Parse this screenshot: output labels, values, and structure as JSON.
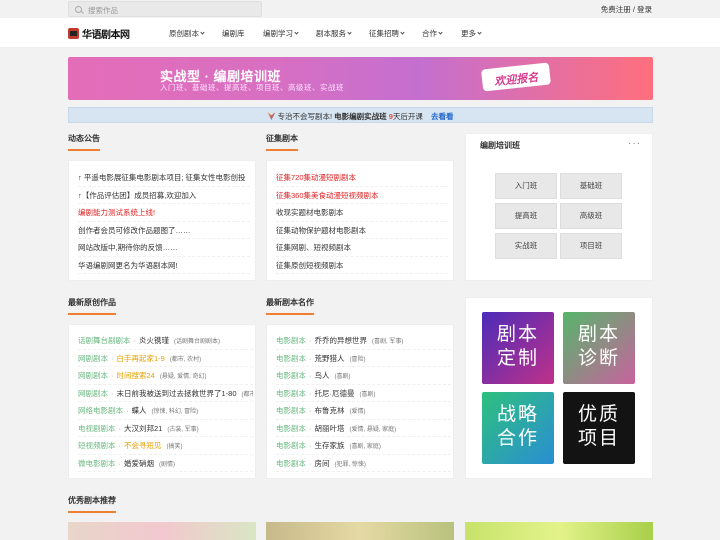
{
  "topbar": {
    "search_placeholder": "搜索作品",
    "auth": "免费注册 / 登录"
  },
  "nav": {
    "logo": "华语剧本网",
    "items": [
      "原创剧本",
      "编剧库",
      "编剧学习",
      "剧本服务",
      "征集招聘",
      "合作",
      "更多"
    ]
  },
  "banner": {
    "title": "实战型 · 编剧培训班",
    "subtitle": "入门班、基础班、提高班、项目班、高级班、实战班",
    "cta": "欢迎报名"
  },
  "notice": {
    "prefix": "专治不会写剧本!",
    "highlight": "电影编剧实战班",
    "count": "9",
    "suffix": "天后开课",
    "link": "去看看"
  },
  "announcements": {
    "title": "动态公告",
    "items": [
      {
        "text": "↑ 平遥电影展征集电影剧本项目; 征集女性电影创投",
        "red": false
      },
      {
        "text": "↑【作品评估团】成员招募,欢迎加入",
        "red": false
      },
      {
        "text": "编剧能力测试系统上线!",
        "red": true
      },
      {
        "text": "创作者会员可修改作品题图了……",
        "red": false
      },
      {
        "text": "网站改版中,期待你的反馈……",
        "red": false
      },
      {
        "text": "华语编剧网更名为华语剧本网!",
        "red": false
      }
    ]
  },
  "collect": {
    "title": "征集剧本",
    "items": [
      {
        "text": "征集720集动漫短剧剧本",
        "red": true
      },
      {
        "text": "征集360集美食动漫短视频剧本",
        "red": true
      },
      {
        "text": "收现实题材电影剧本",
        "red": false
      },
      {
        "text": "征集动物保护题材电影剧本",
        "red": false
      },
      {
        "text": "征集网剧、短视频剧本",
        "red": false
      },
      {
        "text": "征集原创短视频剧本",
        "red": false
      }
    ]
  },
  "training": {
    "title": "编剧培训班",
    "more": "···",
    "buttons": [
      "入门班",
      "基础班",
      "提高班",
      "高级班",
      "实战班",
      "项目班"
    ]
  },
  "latest": {
    "title": "最新原创作品",
    "items": [
      {
        "tag": "话剧舞台剧剧本",
        "name": "炎火镌瑾",
        "meta": "(话剧舞台剧剧本)",
        "gold": false
      },
      {
        "tag": "网剧剧本",
        "name": "白手再起家1-9",
        "meta": "(都市, 农村)",
        "gold": true
      },
      {
        "tag": "网剧剧本",
        "name": "时间搜索24",
        "meta": "(悬疑, 爱情, 奇幻)",
        "gold": true
      },
      {
        "tag": "网剧剧本",
        "name": "末日前我被送到过去拯救世界了1-80",
        "meta": "(都市, 奇幻)",
        "gold": false
      },
      {
        "tag": "网络电影剧本",
        "name": "蝶人",
        "meta": "(惊悚, 科幻, 冒险)",
        "gold": false
      },
      {
        "tag": "电视剧剧本",
        "name": "大汉刘邦21",
        "meta": "(古装, 军事)",
        "gold": false
      },
      {
        "tag": "短视频剧本",
        "name": "不会寻短见",
        "meta": "(搞笑)",
        "gold": true
      },
      {
        "tag": "微电影剧本",
        "name": "婚爱硝烟",
        "meta": "(剧情)",
        "gold": false
      }
    ]
  },
  "famous": {
    "title": "最新剧本名作",
    "items": [
      {
        "tag": "电影剧本",
        "name": "乔乔的异想世界",
        "meta": "(喜剧, 军事)"
      },
      {
        "tag": "电影剧本",
        "name": "荒野猎人",
        "meta": "(冒险)"
      },
      {
        "tag": "电影剧本",
        "name": "鸟人",
        "meta": "(喜剧)"
      },
      {
        "tag": "电影剧本",
        "name": "托尼·厄德曼",
        "meta": "(喜剧)"
      },
      {
        "tag": "电影剧本",
        "name": "布鲁克林",
        "meta": "(爱情)"
      },
      {
        "tag": "电影剧本",
        "name": "胡丽叶塔",
        "meta": "(爱情, 悬疑, 家庭)"
      },
      {
        "tag": "电影剧本",
        "name": "生存家族",
        "meta": "(喜剧, 家庭)"
      },
      {
        "tag": "电影剧本",
        "name": "房间",
        "meta": "(犯罪, 惊悚)"
      }
    ]
  },
  "tiles": [
    {
      "line1": "剧本",
      "line2": "定制"
    },
    {
      "line1": "剧本",
      "line2": "诊断"
    },
    {
      "line1": "战略",
      "line2": "合作"
    },
    {
      "line1": "优质",
      "line2": "项目"
    }
  ],
  "recommend": {
    "title": "优秀剧本推荐"
  }
}
